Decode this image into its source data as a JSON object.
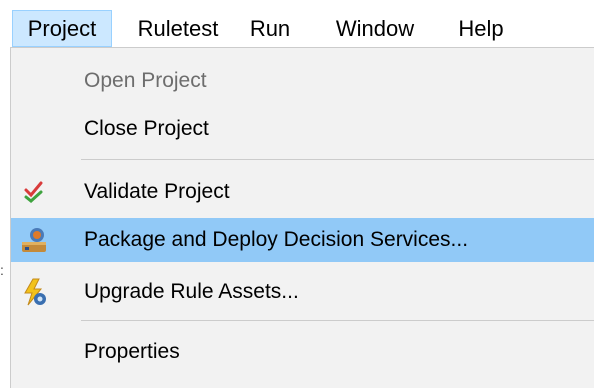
{
  "menubar": {
    "items": [
      {
        "label": "Project",
        "open": true
      },
      {
        "label": "Ruletest"
      },
      {
        "label": "Run"
      },
      {
        "label": "Window"
      },
      {
        "label": "Help"
      }
    ]
  },
  "dropdown": {
    "items": [
      {
        "label": "Open Project",
        "state": "disabled"
      },
      {
        "label": "Close Project"
      },
      {
        "label": "Validate Project",
        "icon": "validate-check-icon"
      },
      {
        "label": "Package and Deploy Decision Services...",
        "icon": "package-deploy-icon",
        "state": "highlighted"
      },
      {
        "label": "Upgrade Rule Assets...",
        "icon": "upgrade-lightning-icon"
      },
      {
        "label": "Properties"
      }
    ]
  },
  "colors": {
    "menubar_open_bg": "#cce8ff",
    "highlight_bg": "#91c9f7",
    "menu_bg": "#f2f2f2",
    "disabled_text": "#6d6d6d"
  }
}
